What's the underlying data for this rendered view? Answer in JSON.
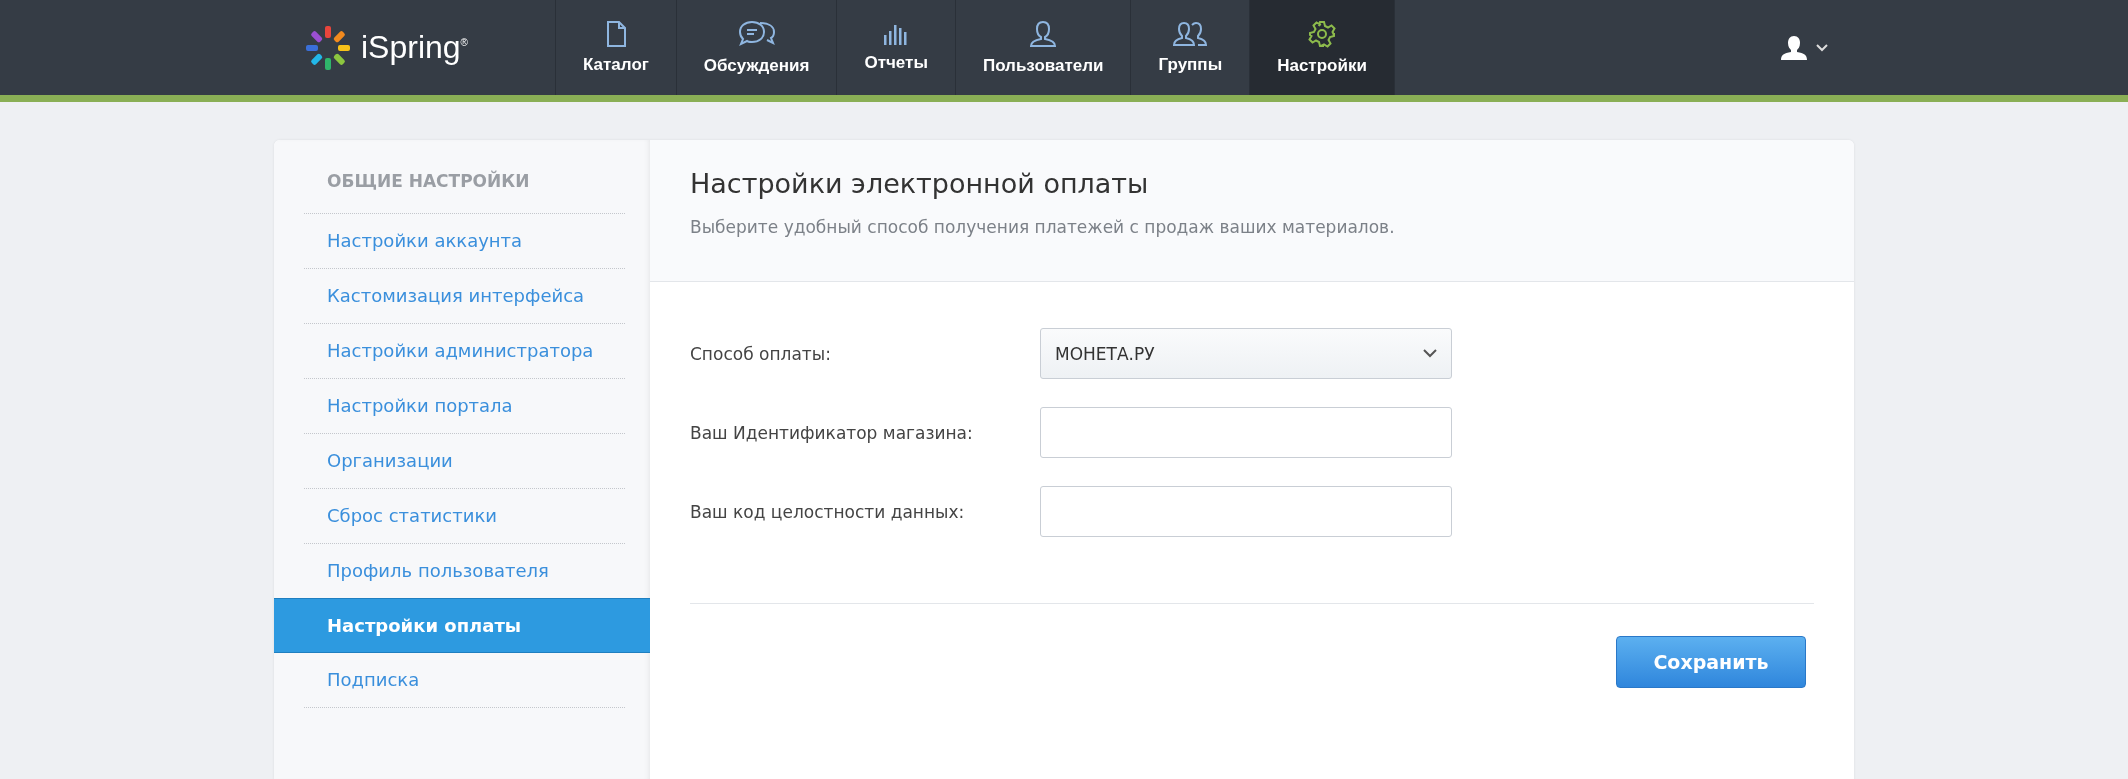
{
  "header": {
    "logo": "iSpring$^{®}$",
    "nav": [
      {
        "label": "Каталог",
        "selected": false
      },
      {
        "label": "Обсуждения",
        "selected": false
      },
      {
        "label": "Отчеты",
        "selected": false
      },
      {
        "label": "Пользователи",
        "selected": false
      },
      {
        "label": "Группы",
        "selected": false
      },
      {
        "label": "Настройки",
        "selected": true
      }
    ]
  },
  "sidebar": {
    "heading": "ОБЩИЕ НАСТРОЙКИ",
    "items": [
      {
        "label": "Настройки аккаунта",
        "selected": false
      },
      {
        "label": "Кастомизация интерфейса",
        "selected": false
      },
      {
        "label": "Настройки администратора",
        "selected": false
      },
      {
        "label": "Настройки портала",
        "selected": false
      },
      {
        "label": "Организации",
        "selected": false
      },
      {
        "label": "Сброс статистики",
        "selected": false
      },
      {
        "label": "Профиль пользователя",
        "selected": false
      },
      {
        "label": "Настройки оплаты",
        "selected": true
      },
      {
        "label": "Подписка",
        "selected": false
      }
    ]
  },
  "content": {
    "title": "Настройки электронной оплаты",
    "subtitle": "Выберите удобный способ получения платежей с продаж ваших материалов.",
    "fields": [
      {
        "kind": "select",
        "label": "Способ оплаты:",
        "value": "МОНЕТА.РУ"
      },
      {
        "kind": "input",
        "label": "Ваш Идентификатор магазина:"
      },
      {
        "kind": "input",
        "label": "Ваш код целостности данных:"
      }
    ],
    "save_button": "Сохранить"
  }
}
